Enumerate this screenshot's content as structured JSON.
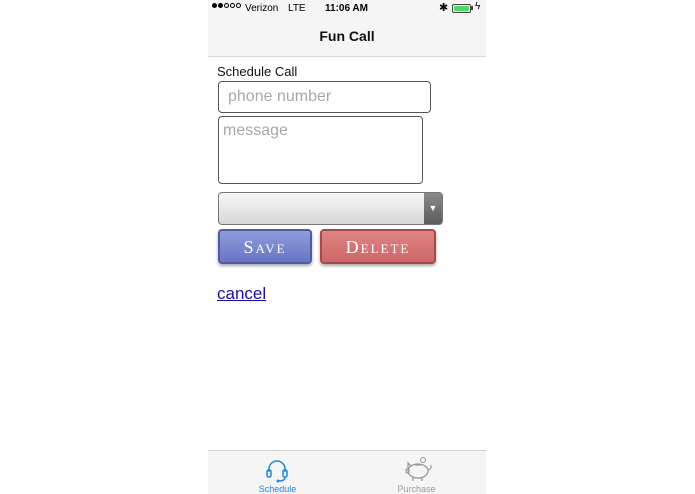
{
  "status_bar": {
    "carrier": "Verizon",
    "network": "LTE",
    "time": "11:06 AM",
    "signal_bars_filled": 2,
    "signal_bars_total": 5,
    "bluetooth_icon": "bluetooth-icon",
    "battery_level": 1.0,
    "charging": true
  },
  "nav": {
    "title": "Fun Call"
  },
  "form": {
    "section_label": "Schedule Call",
    "phone_placeholder": "phone number",
    "phone_value": "",
    "message_placeholder": "message",
    "message_value": "",
    "select_value": "",
    "save_label": "Save",
    "delete_label": "Delete",
    "cancel_label": "cancel"
  },
  "tabbar": {
    "tabs": [
      {
        "label": "Schedule",
        "icon": "headset-icon",
        "active": true
      },
      {
        "label": "Purchase",
        "icon": "piggy-bank-icon",
        "active": false
      }
    ]
  },
  "colors": {
    "save_button": "#7482cd",
    "delete_button": "#d47070",
    "active_tab": "#1e88e5",
    "inactive_tab": "#9a9a9a",
    "link": "#1a0dab"
  }
}
